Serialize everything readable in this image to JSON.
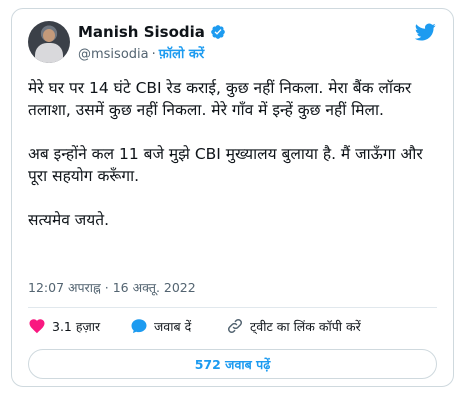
{
  "tweet": {
    "author": {
      "display_name": "Manish Sisodia",
      "handle": "@msisodia",
      "verified": true,
      "follow_label": "फ़ॉलो करें",
      "separator": "·"
    },
    "text_paragraphs": [
      "मेरे घर पर 14 घंटे CBI रेड कराई, कुछ नहीं निकला. मेरा बैंक लॉकर तलाशा, उसमें कुछ नहीं निकला. मेरे गाँव में इन्हें कुछ नहीं मिला.",
      "अब इन्होंने कल 11 बजे मुझे CBI मुख्यालय बुलाया है. मैं जाऊँगा और पूरा सहयोग करूँगा.",
      "सत्यमेव जयते."
    ],
    "timestamp": "12:07 अपराह्न · 16 अक्तू. 2022",
    "actions": {
      "likes_count": "3.1 हज़ार",
      "reply_label": "जवाब दें",
      "copy_link_label": "ट्वीट का लिंक कॉपी करें"
    },
    "replies_button_label": "572 जवाब पढ़ें"
  },
  "icons": {
    "brand": "twitter-bird-icon",
    "verified": "verified-badge-icon",
    "like": "heart-icon",
    "reply": "reply-bubble-icon",
    "link": "link-icon"
  },
  "colors": {
    "accent": "#1d9bf0",
    "like": "#f91880",
    "text": "#0f1419",
    "muted": "#536471",
    "border": "#cfd9de"
  }
}
